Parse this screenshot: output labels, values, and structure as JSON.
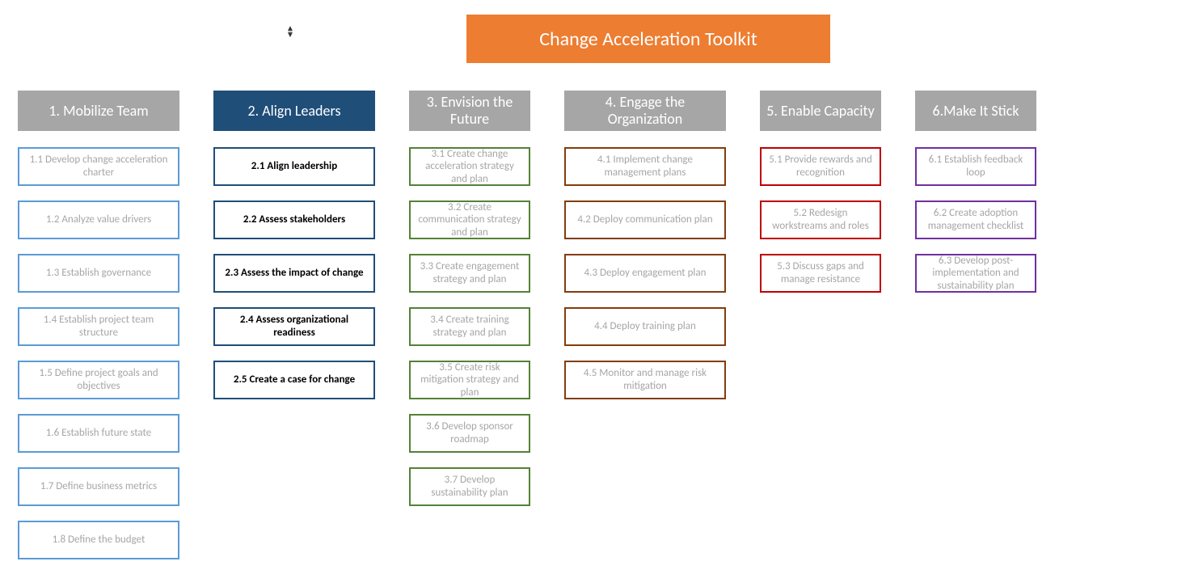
{
  "title": "Change Acceleration Toolkit",
  "columns": [
    {
      "header": "1. Mobilize Team",
      "headerClass": "hdr-grey",
      "boxClass": "b-blue",
      "active": false,
      "widthClass": "",
      "items": [
        "1.1 Develop change acceleration charter",
        "1.2 Analyze value drivers",
        "1.3 Establish governance",
        "1.4 Establish project team structure",
        "1.5 Define project goals and objectives",
        "1.6 Establish future state",
        "1.7 Define business metrics",
        "1.8 Define the budget"
      ]
    },
    {
      "header": "2. Align Leaders",
      "headerClass": "hdr-navy",
      "boxClass": "b-navy",
      "active": true,
      "widthClass": "",
      "items": [
        "2.1 Align leadership",
        "2.2 Assess stakeholders",
        "2.3 Assess the impact of change",
        "2.4 Assess organizational readiness",
        "2.5 Create a case for change"
      ]
    },
    {
      "header": "3. Envision the Future",
      "headerClass": "hdr-grey",
      "boxClass": "b-green",
      "active": false,
      "widthClass": "narrow",
      "items": [
        "3.1 Create change acceleration strategy and plan",
        "3.2 Create communication strategy and plan",
        "3.3 Create engagement strategy and plan",
        "3.4 Create training strategy and plan",
        "3.5 Create risk mitigation strategy and plan",
        "3.6 Develop sponsor roadmap",
        "3.7 Develop sustainability plan"
      ]
    },
    {
      "header": "4. Engage the Organization",
      "headerClass": "hdr-grey",
      "boxClass": "b-brown",
      "active": false,
      "widthClass": "",
      "items": [
        "4.1 Implement change management plans",
        "4.2 Deploy communication plan",
        "4.3 Deploy engagement plan",
        "4.4 Deploy training plan",
        "4.5 Monitor and manage risk mitigation"
      ]
    },
    {
      "header": "5. Enable Capacity",
      "headerClass": "hdr-grey",
      "boxClass": "b-red",
      "active": false,
      "widthClass": "narrow",
      "items": [
        "5.1 Provide rewards and recognition",
        "5.2 Redesign workstreams and roles",
        "5.3 Discuss gaps and manage resistance"
      ]
    },
    {
      "header": "6.Make It Stick",
      "headerClass": "hdr-grey",
      "boxClass": "b-purple",
      "active": false,
      "widthClass": "narrow",
      "items": [
        "6.1 Establish feedback loop",
        "6.2 Create adoption management checklist",
        "6.3 Develop post-implementation and sustainability plan"
      ]
    }
  ]
}
